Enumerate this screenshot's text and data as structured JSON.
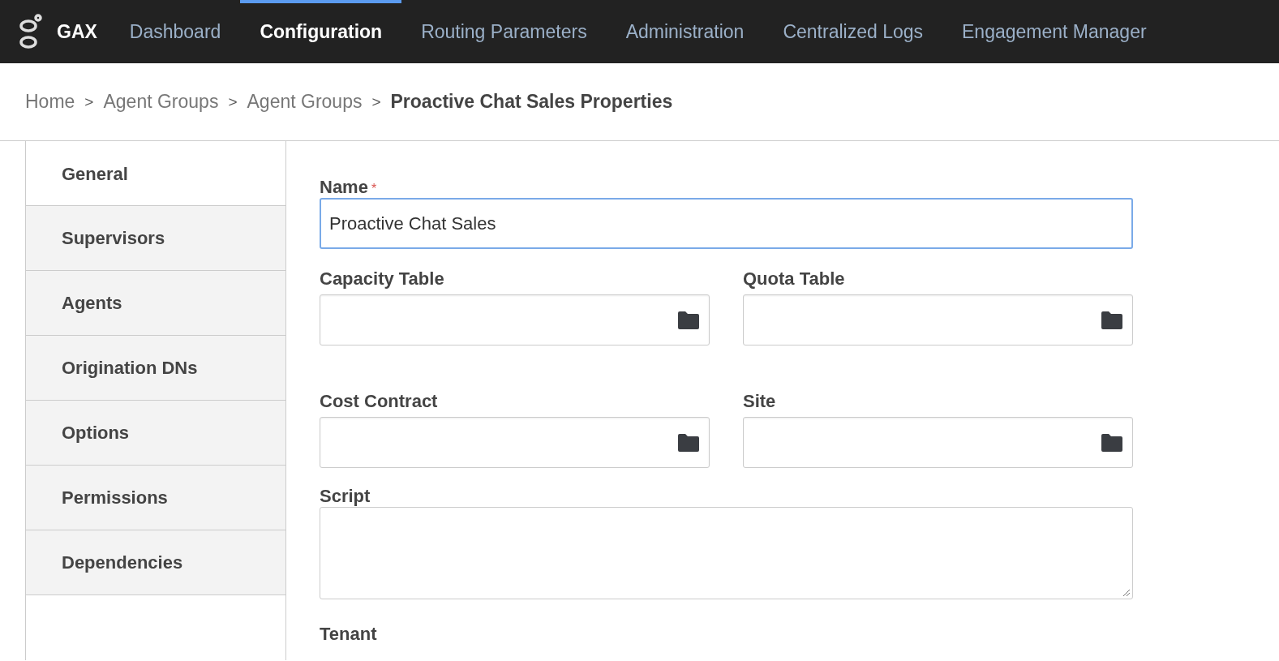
{
  "navbar": {
    "brand": "GAX",
    "items": [
      {
        "label": "Dashboard",
        "selected": false
      },
      {
        "label": "Configuration",
        "selected": true
      },
      {
        "label": "Routing Parameters",
        "selected": false
      },
      {
        "label": "Administration",
        "selected": false
      },
      {
        "label": "Centralized Logs",
        "selected": false
      },
      {
        "label": "Engagement Manager",
        "selected": false
      }
    ]
  },
  "breadcrumb": {
    "items": [
      "Home",
      "Agent Groups",
      "Agent Groups"
    ],
    "separator": ">",
    "current": "Proactive Chat Sales Properties"
  },
  "side_tabs": [
    {
      "label": "General",
      "selected": true
    },
    {
      "label": "Supervisors",
      "selected": false
    },
    {
      "label": "Agents",
      "selected": false
    },
    {
      "label": "Origination DNs",
      "selected": false
    },
    {
      "label": "Options",
      "selected": false
    },
    {
      "label": "Permissions",
      "selected": false
    },
    {
      "label": "Dependencies",
      "selected": false
    }
  ],
  "form": {
    "name": {
      "label": "Name",
      "required_mark": "*",
      "value": "Proactive Chat Sales"
    },
    "lookup_rows": [
      [
        {
          "label": "Capacity Table"
        },
        {
          "label": "Quota Table"
        }
      ],
      [
        {
          "label": "Cost Contract"
        },
        {
          "label": "Site"
        }
      ]
    ],
    "script": {
      "label": "Script"
    },
    "tenant": {
      "label": "Tenant"
    }
  }
}
